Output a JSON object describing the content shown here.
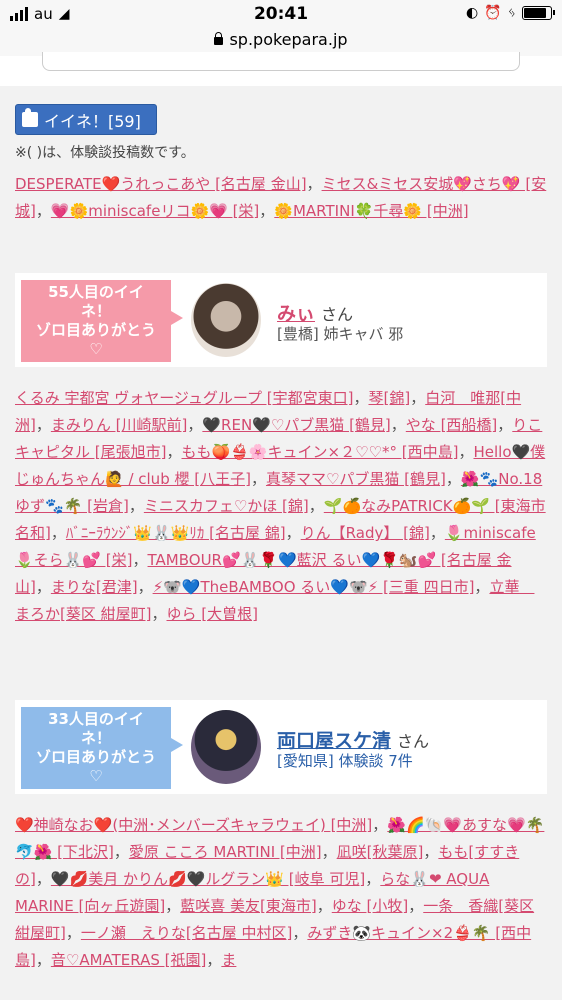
{
  "status": {
    "carrier": "au",
    "time": "20:41",
    "battery_level": 0.9
  },
  "url": "sp.pokepara.jp",
  "like_button": {
    "label": "イイネ！[59]"
  },
  "note": "※( )は、体験談投稿数です。",
  "top_names": [
    "DESPERATE❤️うれっこあや [名古屋 金山]",
    "ミセス&ミセス安城💖さち💖 [安城]",
    "💗🌼miniscafeリコ🌼💗 [栄]",
    "🌼MARTINI🍀千尋🌼 [中洲]"
  ],
  "card1": {
    "badge_line1": "55人目のイイ",
    "badge_line2": "ネ！",
    "badge_line3": "ゾロ目ありがとう",
    "badge_heart": "♡",
    "name": "みぃ",
    "san": "さん",
    "sub": "[豊橋] 姉キャバ 邪",
    "accent": "#f59aa9",
    "name_color": "#d44a70"
  },
  "card1_names": [
    "くるみ 宇都宮 ヴォヤージュグループ [宇都宮東口]",
    "琴[錦]",
    "白河　唯那[中洲]",
    "まみりん [川崎駅前]",
    "🖤REN🖤♡パブ黒猫 [鶴見]",
    "やな [西船橋]",
    "りこ キャピタル [尾張旭市]",
    "もも🍑👙🌸キュイン×２♡♡*° [西中島]",
    "Hello🖤僕じゅんちゃん🙋 / club 櫻 [八王子]",
    "真琴ママ♡パブ黒猫 [鶴見]",
    "🌺🐾No.18ゆず🐾🌴 [岩倉]",
    "ミニスカフェ♡かほ [錦]",
    "🌱🍊なみPATRICK🍊🌱 [東海市 名和]",
    "ﾊﾞﾆｰﾗｳﾝｼﾞ👑🐰👑ﾘｶ [名古屋 錦]",
    "りん【Rady】 [錦]",
    "🌷miniscafe🌷そら🐰💕 [栄]",
    "TAMBOUR💕🐰🌹💙藍沢 るい💙🌹🐿️💕 [名古屋 金山]",
    "まりな[君津]",
    "⚡🐨💙TheBAMBOO るい💙🐨⚡ [三重 四日市]",
    "立華　まろか[葵区 紺屋町]",
    "ゆら [大曽根]"
  ],
  "card2": {
    "badge_line1": "33人目のイイ",
    "badge_line2": "ネ！",
    "badge_line3": "ゾロ目ありがとう",
    "badge_heart": "♡",
    "name": "両口屋スケ清",
    "san": "さん",
    "sub": "[愛知県] 体験談 7件",
    "accent": "#8fbbea",
    "name_color": "#2a5fa8"
  },
  "card2_names": [
    "❤️神崎なお❤️(中洲･メンバーズキャラウェイ) [中洲]",
    "🌺🌈🐚💗あすな💗🌴🐬🌺 [下北沢]",
    "愛原 こころ MARTINI [中洲]",
    "凪咲[秋葉原]",
    "もも[すすきの]",
    "🖤💋美月 かりん💋🖤ルグラン👑 [岐阜 可児]",
    "らな🐰❤ AQUA MARINE [向ヶ丘遊園]",
    "藍咲喜 美友[東海市]",
    "ゆな [小牧]",
    "一条　香織[葵区 紺屋町]",
    "一ノ瀬　えりな[名古屋 中村区]",
    "みずき🐼キュイン×2👙🌴 [西中島]",
    "音♡AMATERAS [祇園]",
    "ま"
  ]
}
